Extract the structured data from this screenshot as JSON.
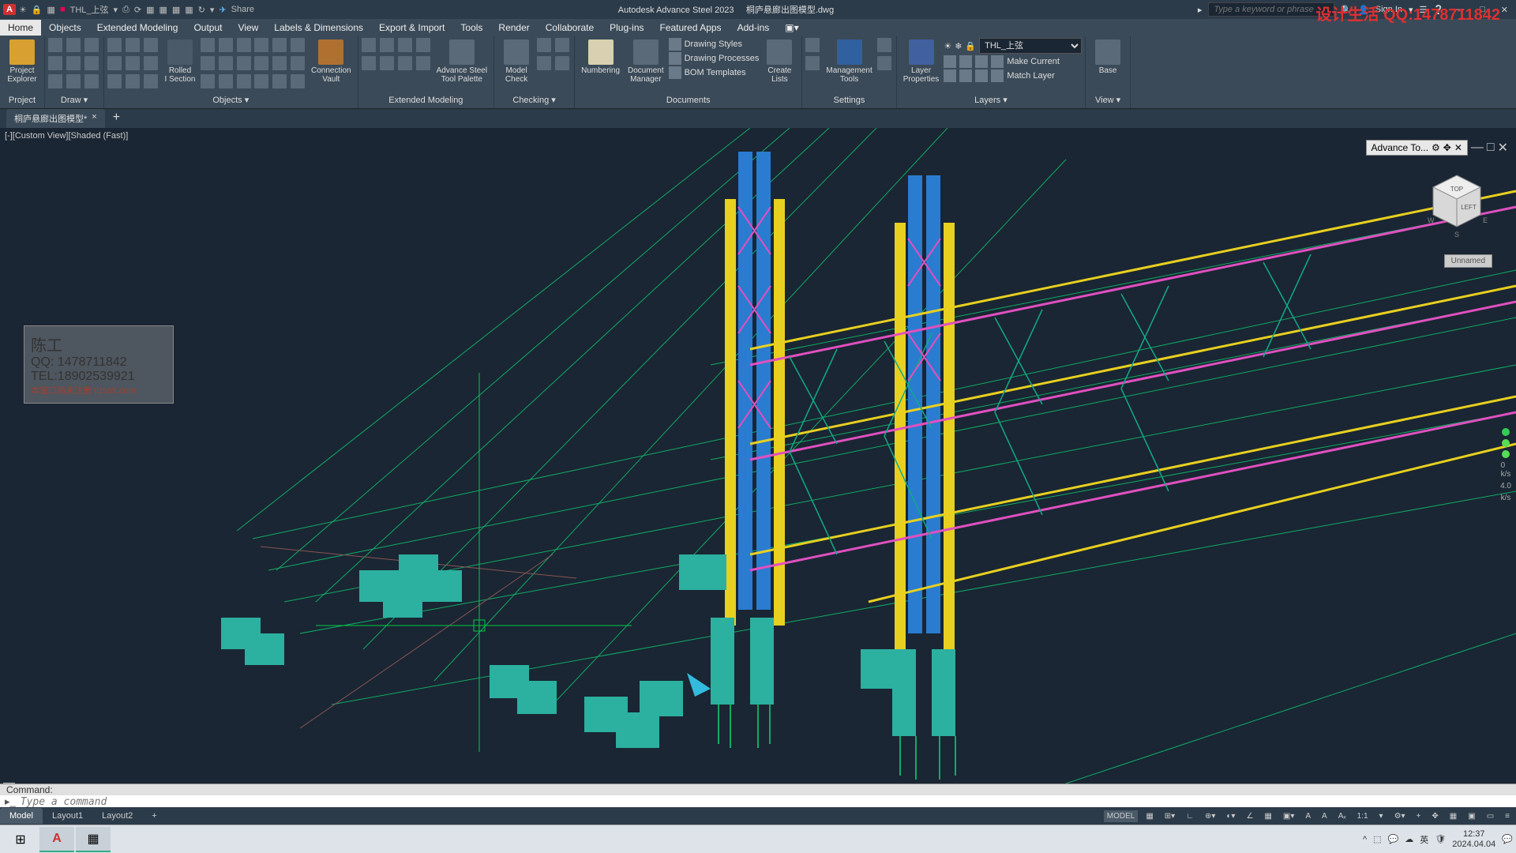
{
  "titlebar": {
    "app_letter": "A",
    "qat_layer_label": "THL_上弦",
    "share": "Share",
    "app_name": "Autodesk Advance Steel 2023",
    "file": "桐庐悬廊出图模型.dwg",
    "search_ph": "Type a keyword or phrase",
    "signin": "Sign In",
    "min": "—",
    "max": "□",
    "close": "✕"
  },
  "watermark": "设计生活 QQ:1478711842",
  "menus": [
    "Home",
    "Objects",
    "Extended Modeling",
    "Output",
    "View",
    "Labels & Dimensions",
    "Export & Import",
    "Tools",
    "Render",
    "Collaborate",
    "Plug-ins",
    "Featured Apps",
    "Add-ins"
  ],
  "ribbon": {
    "project": {
      "btn": "Project\nExplorer",
      "title": "Project"
    },
    "draw": {
      "title": "Draw ▾"
    },
    "objects": {
      "rolled": "Rolled\nI Section",
      "conn": "Connection\nVault",
      "title": "Objects ▾"
    },
    "extmod": {
      "btn1": "Advance Steel\nTool Palette",
      "btn2": "Model\nCheck",
      "title": "Extended Modeling"
    },
    "checking": {
      "title": "Checking ▾"
    },
    "documents": {
      "num": "Numbering",
      "docmgr": "Document\nManager",
      "styles": "Drawing Styles",
      "proc": "Drawing Processes",
      "bom": "BOM Templates",
      "lists": "Create\nLists",
      "title": "Documents"
    },
    "settings": {
      "mgmt": "Management\nTools",
      "title": "Settings"
    },
    "layers": {
      "props": "Layer\nProperties",
      "current": "THL_上弦",
      "make": "Make Current",
      "match": "Match Layer",
      "title": "Layers ▾"
    },
    "view": {
      "base": "Base",
      "title": "View ▾"
    }
  },
  "filetab": {
    "name": "桐庐悬廊出图模型*",
    "close": "×",
    "add": "+"
  },
  "viewport": {
    "label": "[-][Custom View][Shaded (Fast)]",
    "info": {
      "r1": "陈工",
      "r2": "QQ: 1478711842",
      "r3": "TEL:18902539921",
      "r4": "本窗口尚未注册 tlzsoft.com"
    },
    "navbox": "Advance To...",
    "unnamed": "Unnamed",
    "speed": "4.0",
    "cube": {
      "top": "TOP",
      "left": "LEFT",
      "w": "W",
      "e": "E",
      "s": "S"
    }
  },
  "cmd": {
    "hist": "Command:",
    "placeholder": "Type a command",
    "x": "✕"
  },
  "layouts": [
    "Model",
    "Layout1",
    "Layout2"
  ],
  "layout_add": "+",
  "status": {
    "model": "MODEL",
    "scale": "1:1"
  },
  "taskbar": {
    "win": "⊞",
    "clock_t": "12:37",
    "clock_d": "2024.04.04"
  }
}
